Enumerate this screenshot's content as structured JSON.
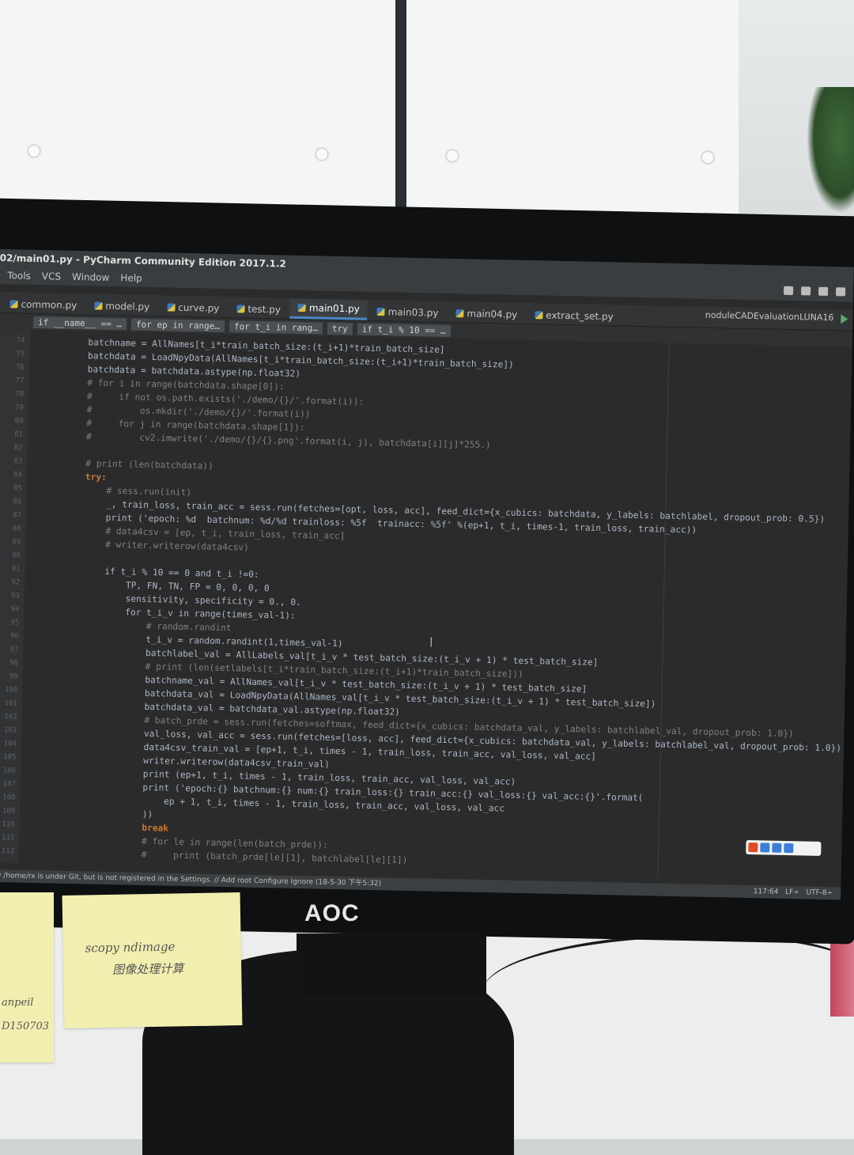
{
  "window": {
    "title": "02/main01.py - PyCharm Community Edition 2017.1.2"
  },
  "menu": [
    "Tools",
    "VCS",
    "Window",
    "Help"
  ],
  "tabs": [
    {
      "label": "common.py",
      "active": false
    },
    {
      "label": "model.py",
      "active": false
    },
    {
      "label": "curve.py",
      "active": false
    },
    {
      "label": "test.py",
      "active": false
    },
    {
      "label": "main01.py",
      "active": true
    },
    {
      "label": "main03.py",
      "active": false
    },
    {
      "label": "main04.py",
      "active": false
    },
    {
      "label": "extract_set.py",
      "active": false
    }
  ],
  "run_config": "noduleCADEvaluationLUNA16",
  "breadcrumbs": [
    "if __name__ == …",
    "for ep in range…",
    "for t_i in rang…",
    "try",
    "if t_i % 10 == …"
  ],
  "code_lines": [
    {
      "n": "74",
      "t": "        batchname = AllNames[t_i*train_batch_size:(t_i+1)*train_batch_size]",
      "c": ""
    },
    {
      "n": "75",
      "t": "        batchdata = LoadNpyData(AllNames[t_i*train_batch_size:(t_i+1)*train_batch_size])",
      "c": ""
    },
    {
      "n": "76",
      "t": "        batchdata = batchdata.astype(np.float32)",
      "c": ""
    },
    {
      "n": "77",
      "t": "        # for i in range(batchdata.shape[0]):",
      "c": "comment"
    },
    {
      "n": "78",
      "t": "        #     if not os.path.exists('./demo/{}/'.format(i)):",
      "c": "comment"
    },
    {
      "n": "79",
      "t": "        #         os.mkdir('./demo/{}/'.format(i))",
      "c": "comment"
    },
    {
      "n": "80",
      "t": "        #     for j in range(batchdata.shape[1]):",
      "c": "comment"
    },
    {
      "n": "81",
      "t": "        #         cv2.imwrite('./demo/{}/{}.png'.format(i, j), batchdata[i][j]*255.)",
      "c": "comment"
    },
    {
      "n": "82",
      "t": "",
      "c": ""
    },
    {
      "n": "83",
      "t": "        # print (len(batchdata))",
      "c": "comment"
    },
    {
      "n": "84",
      "t": "        try:",
      "c": "kw"
    },
    {
      "n": "85",
      "t": "            # sess.run(init)",
      "c": "comment"
    },
    {
      "n": "86",
      "t": "            _, train_loss, train_acc = sess.run(fetches=[opt, loss, acc], feed_dict={x_cubics: batchdata, y_labels: batchlabel, dropout_prob: 0.5})",
      "c": ""
    },
    {
      "n": "87",
      "t": "            print ('epoch: %d  batchnum: %d/%d trainloss: %5f  trainacc: %5f' %(ep+1, t_i, times-1, train_loss, train_acc))",
      "c": "hl"
    },
    {
      "n": "88",
      "t": "            # data4csv = [ep, t_i, train_loss, train_acc]",
      "c": "comment"
    },
    {
      "n": "89",
      "t": "            # writer.writerow(data4csv)",
      "c": "comment"
    },
    {
      "n": "90",
      "t": "",
      "c": ""
    },
    {
      "n": "91",
      "t": "            if t_i % 10 == 0 and t_i !=0:",
      "c": ""
    },
    {
      "n": "92",
      "t": "                TP, FN, TN, FP = 0, 0, 0, 0",
      "c": ""
    },
    {
      "n": "93",
      "t": "                sensitivity, specificity = 0., 0.",
      "c": ""
    },
    {
      "n": "94",
      "t": "                for t_i_v in range(times_val-1):",
      "c": ""
    },
    {
      "n": "95",
      "t": "                    # random.randint",
      "c": "comment"
    },
    {
      "n": "96",
      "t": "                    t_i_v = random.randint(1,times_val-1)",
      "c": ""
    },
    {
      "n": "97",
      "t": "                    batchlabel_val = AllLabels_val[t_i_v * test_batch_size:(t_i_v + 1) * test_batch_size]",
      "c": ""
    },
    {
      "n": "98",
      "t": "                    # print (len(setlabels[t_i*train_batch_size:(t_i+1)*train_batch_size]))",
      "c": "comment"
    },
    {
      "n": "99",
      "t": "                    batchname_val = AllNames_val[t_i_v * test_batch_size:(t_i_v + 1) * test_batch_size]",
      "c": ""
    },
    {
      "n": "100",
      "t": "                    batchdata_val = LoadNpyData(AllNames_val[t_i_v * test_batch_size:(t_i_v + 1) * test_batch_size])",
      "c": ""
    },
    {
      "n": "101",
      "t": "                    batchdata_val = batchdata_val.astype(np.float32)",
      "c": ""
    },
    {
      "n": "102",
      "t": "                    # batch_prde = sess.run(fetches=softmax, feed_dict={x_cubics: batchdata_val, y_labels: batchlabel_val, dropout_prob: 1.0})",
      "c": "comment"
    },
    {
      "n": "103",
      "t": "                    val_loss, val_acc = sess.run(fetches=[loss, acc], feed_dict={x_cubics: batchdata_val, y_labels: batchlabel_val, dropout_prob: 1.0})",
      "c": ""
    },
    {
      "n": "104",
      "t": "                    data4csv_train_val = [ep+1, t_i, times - 1, train_loss, train_acc, val_loss, val_acc]",
      "c": ""
    },
    {
      "n": "105",
      "t": "                    writer.writerow(data4csv_train_val)",
      "c": ""
    },
    {
      "n": "106",
      "t": "                    print (ep+1, t_i, times - 1, train_loss, train_acc, val_loss, val_acc)",
      "c": ""
    },
    {
      "n": "107",
      "t": "                    print ('epoch:{} batchnum:{} num:{} train_loss:{} train_acc:{} val_loss:{} val_acc:{}'.format(",
      "c": ""
    },
    {
      "n": "108",
      "t": "                        ep + 1, t_i, times - 1, train_loss, train_acc, val_loss, val_acc",
      "c": ""
    },
    {
      "n": "109",
      "t": "                    ))",
      "c": ""
    },
    {
      "n": "110",
      "t": "                    break",
      "c": "kw"
    },
    {
      "n": "111",
      "t": "                    # for le in range(len(batch_prde)):",
      "c": "comment"
    },
    {
      "n": "112",
      "t": "                    #     print (batch_prde[le][1], batchlabel[le][1])",
      "c": "comment"
    }
  ],
  "status": {
    "message": "tory /home/rx is under Git, but is not registered in the Settings. // Add root  Configure  Ignore (18-5-30 下午5:32)",
    "position": "117:64",
    "line_sep": "LF÷",
    "encoding": "UTF-8÷"
  },
  "desk": {
    "brand": "AOC",
    "note2_line1": "scopy    ndimage",
    "note2_line2": "图像处理计算",
    "note1_line1": "anpeil",
    "note1_line2": "D150703"
  }
}
